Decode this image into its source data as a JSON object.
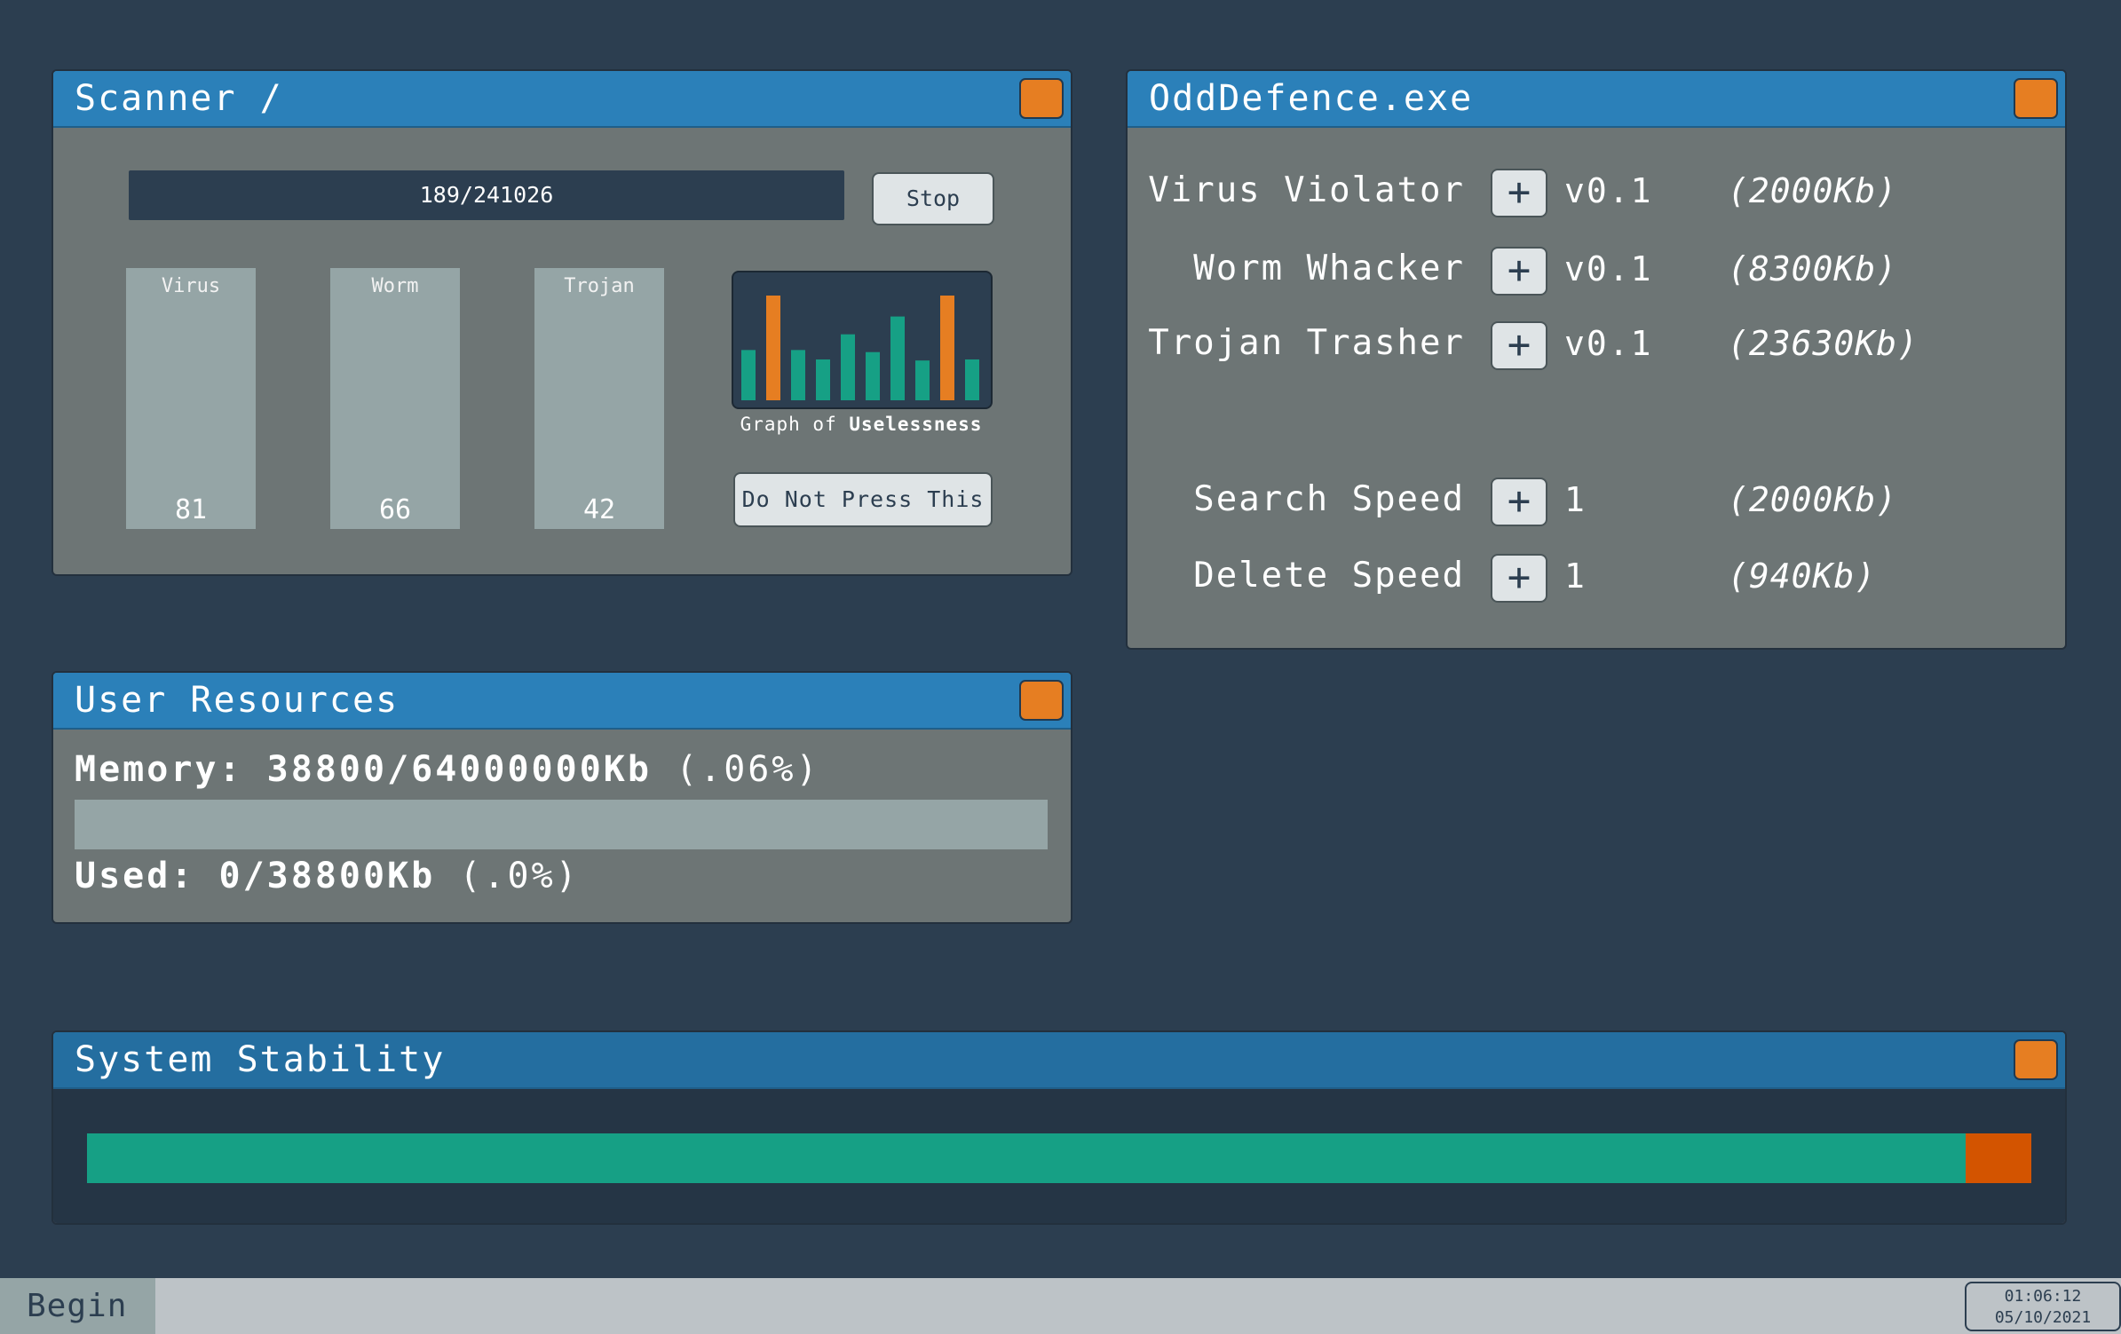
{
  "scanner": {
    "title": "Scanner /",
    "progress_text": "189/241026",
    "stop_label": "Stop",
    "threats": [
      {
        "name": "Virus",
        "count": "81"
      },
      {
        "name": "Worm",
        "count": "66"
      },
      {
        "name": "Trojan",
        "count": "42"
      }
    ],
    "graph_caption_prefix": "Graph of ",
    "graph_caption_bold": "Uselessness",
    "graph_bars": [
      {
        "value": 0.48,
        "color": "#16a085"
      },
      {
        "value": 1.0,
        "color": "#e67e22"
      },
      {
        "value": 0.48,
        "color": "#16a085"
      },
      {
        "value": 0.39,
        "color": "#16a085"
      },
      {
        "value": 0.63,
        "color": "#16a085"
      },
      {
        "value": 0.46,
        "color": "#16a085"
      },
      {
        "value": 0.8,
        "color": "#16a085"
      },
      {
        "value": 0.38,
        "color": "#16a085"
      },
      {
        "value": 1.0,
        "color": "#e67e22"
      },
      {
        "value": 0.39,
        "color": "#16a085"
      }
    ],
    "do_not_press_label": "Do Not Press This"
  },
  "odddefence": {
    "title": "OddDefence.exe",
    "plus_symbol": "+",
    "tools": [
      {
        "name": "Virus Violator",
        "version": "v0.1",
        "size": "(2000Kb)"
      },
      {
        "name": "Worm Whacker",
        "version": "v0.1",
        "size": "(8300Kb)"
      },
      {
        "name": "Trojan Trasher",
        "version": "v0.1",
        "size": "(23630Kb)"
      }
    ],
    "upgrades": [
      {
        "name": "Search Speed",
        "level": "1",
        "size": "(2000Kb)"
      },
      {
        "name": "Delete Speed",
        "level": "1",
        "size": "(940Kb)"
      }
    ]
  },
  "resources": {
    "title": "User Resources",
    "memory_label": "Memory: 38800/64000000Kb",
    "memory_percent": "(.06%)",
    "used_label": "Used: 0/38800Kb",
    "used_percent": "(.0%)",
    "used_fraction": 0
  },
  "stability": {
    "title": "System Stability",
    "fraction": 0.966
  },
  "taskbar": {
    "begin_label": "Begin",
    "time": "01:06:12",
    "date": "05/10/2021"
  },
  "colors": {
    "accent": "#e67e22",
    "titlebar": "#2b80b9",
    "stable": "#16a085",
    "unstable": "#d35400",
    "background": "#2c3e50"
  }
}
